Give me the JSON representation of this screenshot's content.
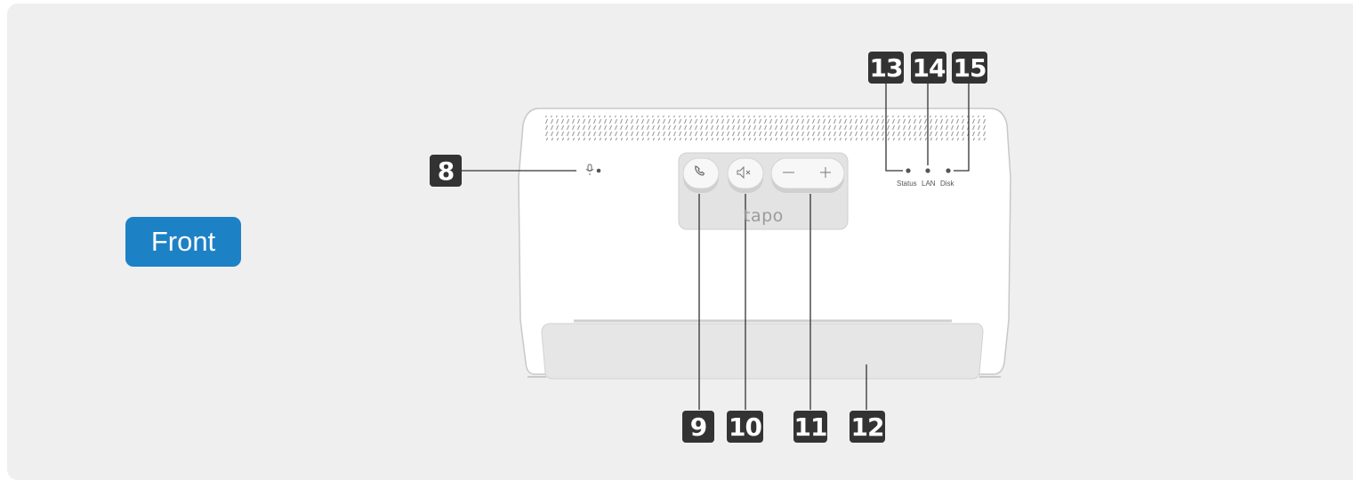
{
  "badge": {
    "label": "Front"
  },
  "callouts": {
    "c8": "8",
    "c9": "9",
    "c10": "10",
    "c11": "11",
    "c12": "12",
    "c13": "13",
    "c14": "14",
    "c15": "15"
  },
  "leds": {
    "status": "Status",
    "lan": "LAN",
    "disk": "Disk"
  },
  "device": {
    "logo": "tapo"
  },
  "colors": {
    "panel": "#efefef",
    "badge": "#1d81c6",
    "callout": "#333333",
    "device_body": "#ffffff",
    "device_outline": "#c9c9c9"
  },
  "icons": {
    "call_button": "phone-icon",
    "mute_button": "speaker-mute-icon",
    "volume_down": "minus-icon",
    "volume_up": "plus-icon",
    "microphone": "microphone-icon"
  }
}
